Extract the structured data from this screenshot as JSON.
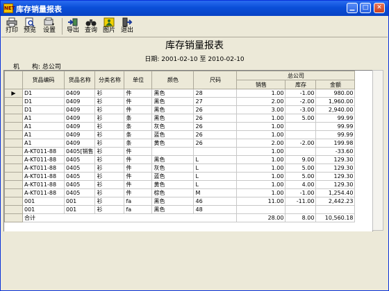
{
  "window": {
    "app_icon": "NET",
    "title": "库存销量报表",
    "minimize_icon": "minimize-icon",
    "maximize_icon": "maximize-icon",
    "close_icon": "close-icon"
  },
  "toolbar": {
    "items": [
      {
        "label": "打印",
        "icon": "printer-icon"
      },
      {
        "label": "预览",
        "icon": "preview-icon"
      },
      {
        "label": "设置",
        "icon": "settings-icon"
      },
      {
        "label": "导出",
        "icon": "export-icon"
      },
      {
        "label": "查询",
        "icon": "binoculars-icon"
      },
      {
        "label": "图片",
        "icon": "picture-icon"
      },
      {
        "label": "退出",
        "icon": "exit-icon"
      }
    ]
  },
  "report": {
    "title": "库存销量报表",
    "date_label": "日期:",
    "date_from": "2001-02-10",
    "date_to_word": "至",
    "date_to": "2010-02-10",
    "org_label": "机　　构:",
    "org_value": "总公司"
  },
  "grid": {
    "headers": {
      "code": "货品编码",
      "name": "货品名称",
      "category": "分类名称",
      "unit": "单位",
      "color": "颜色",
      "size": "尺码",
      "group": "总公司",
      "sales": "销售",
      "stock": "库存",
      "amount": "金额"
    },
    "rows": [
      {
        "indicator": "▶",
        "code": "D1",
        "name": "0409",
        "category": "衫",
        "unit": "件",
        "color": "黑色",
        "size": "28",
        "sales": "1.00",
        "stock": "-1.00",
        "amount": "980.00"
      },
      {
        "indicator": "",
        "code": "D1",
        "name": "0409",
        "category": "衫",
        "unit": "件",
        "color": "黑色",
        "size": "27",
        "sales": "2.00",
        "stock": "-2.00",
        "amount": "1,960.00"
      },
      {
        "indicator": "",
        "code": "D1",
        "name": "0409",
        "category": "衫",
        "unit": "件",
        "color": "黑色",
        "size": "26",
        "sales": "3.00",
        "stock": "-3.00",
        "amount": "2,940.00"
      },
      {
        "indicator": "",
        "code": "A1",
        "name": "0409",
        "category": "衫",
        "unit": "条",
        "color": "黑色",
        "size": "26",
        "sales": "1.00",
        "stock": "5.00",
        "amount": "99.99"
      },
      {
        "indicator": "",
        "code": "A1",
        "name": "0409",
        "category": "衫",
        "unit": "条",
        "color": "灰色",
        "size": "26",
        "sales": "1.00",
        "stock": "",
        "amount": "99.99"
      },
      {
        "indicator": "",
        "code": "A1",
        "name": "0409",
        "category": "衫",
        "unit": "条",
        "color": "蓝色",
        "size": "26",
        "sales": "1.00",
        "stock": "",
        "amount": "99.99"
      },
      {
        "indicator": "",
        "code": "A1",
        "name": "0409",
        "category": "衫",
        "unit": "条",
        "color": "黄色",
        "size": "26",
        "sales": "2.00",
        "stock": "-2.00",
        "amount": "199.98"
      },
      {
        "indicator": "",
        "code": "A-KT011-88",
        "name": "0405[销售",
        "category": "衫",
        "unit": "件",
        "color": "",
        "size": "",
        "sales": "1.00",
        "stock": "",
        "amount": "-33.60"
      },
      {
        "indicator": "",
        "code": "A-KT011-88",
        "name": "0405",
        "category": "衫",
        "unit": "件",
        "color": "黑色",
        "size": "L",
        "sales": "1.00",
        "stock": "9.00",
        "amount": "129.30"
      },
      {
        "indicator": "",
        "code": "A-KT011-88",
        "name": "0405",
        "category": "衫",
        "unit": "件",
        "color": "灰色",
        "size": "L",
        "sales": "1.00",
        "stock": "5.00",
        "amount": "129.30"
      },
      {
        "indicator": "",
        "code": "A-KT011-88",
        "name": "0405",
        "category": "衫",
        "unit": "件",
        "color": "蓝色",
        "size": "L",
        "sales": "1.00",
        "stock": "5.00",
        "amount": "129.30"
      },
      {
        "indicator": "",
        "code": "A-KT011-88",
        "name": "0405",
        "category": "衫",
        "unit": "件",
        "color": "黄色",
        "size": "L",
        "sales": "1.00",
        "stock": "4.00",
        "amount": "129.30"
      },
      {
        "indicator": "",
        "code": "A-KT011-88",
        "name": "0405",
        "category": "衫",
        "unit": "件",
        "color": "棕色",
        "size": "M",
        "sales": "1.00",
        "stock": "-1.00",
        "amount": "1,254.40"
      },
      {
        "indicator": "",
        "code": "001",
        "name": "001",
        "category": "衫",
        "unit": "fa",
        "color": "黑色",
        "size": "46",
        "sales": "11.00",
        "stock": "-11.00",
        "amount": "2,442.23"
      },
      {
        "indicator": "",
        "code": "001",
        "name": "001",
        "category": "衫",
        "unit": "fa",
        "color": "黑色",
        "size": "48",
        "sales": "",
        "stock": "",
        "amount": ""
      }
    ],
    "total": {
      "label": "合计",
      "sales": "28.00",
      "stock": "8.00",
      "amount": "10,560.18"
    }
  }
}
